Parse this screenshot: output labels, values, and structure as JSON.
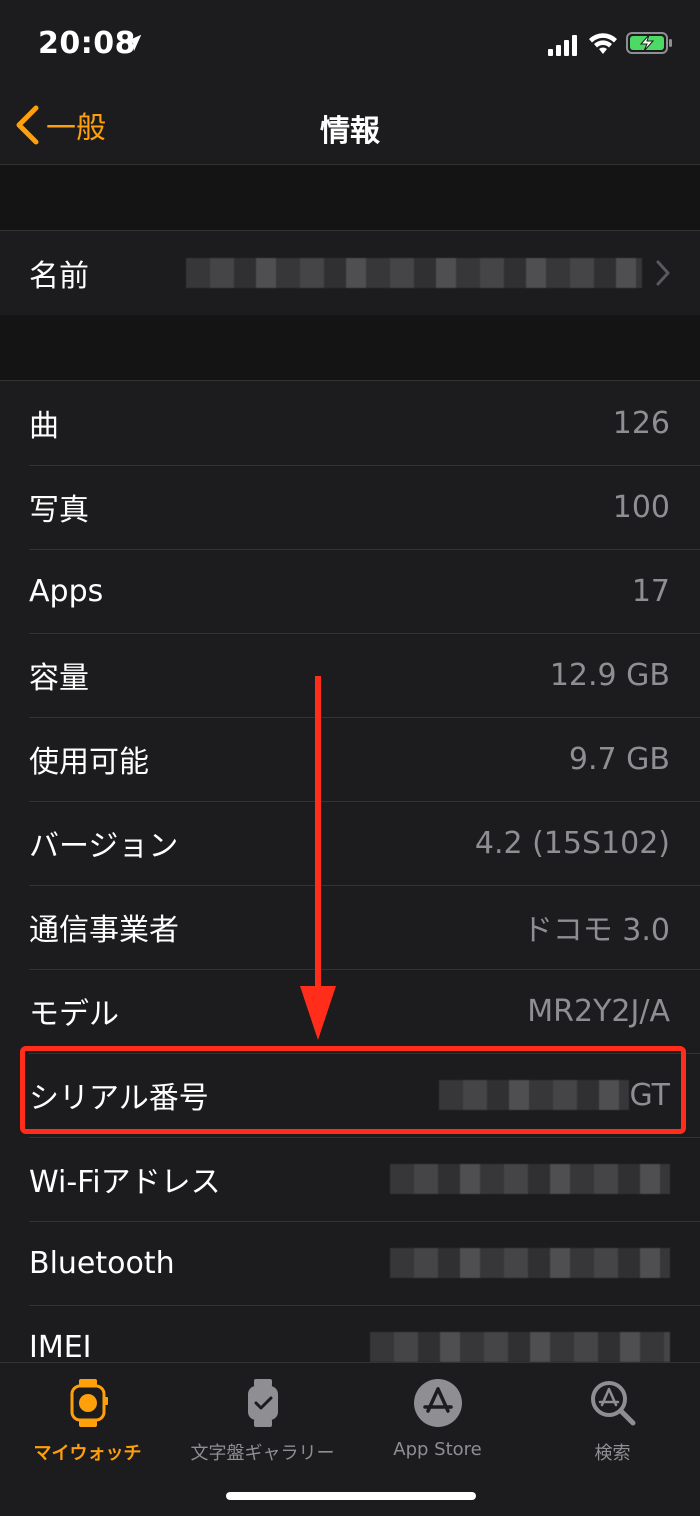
{
  "status_bar": {
    "time": "20:08"
  },
  "nav": {
    "back_label": "一般",
    "title": "情報"
  },
  "name_row": {
    "label": "名前"
  },
  "rows": [
    {
      "label": "曲",
      "value": "126"
    },
    {
      "label": "写真",
      "value": "100"
    },
    {
      "label": "Apps",
      "value": "17"
    },
    {
      "label": "容量",
      "value": "12.9 GB"
    },
    {
      "label": "使用可能",
      "value": "9.7 GB"
    },
    {
      "label": "バージョン",
      "value": "4.2 (15S102)"
    },
    {
      "label": "通信事業者",
      "value": "ドコモ 3.0"
    },
    {
      "label": "モデル",
      "value": "MR2Y2J/A"
    },
    {
      "label": "シリアル番号",
      "value": "GT"
    },
    {
      "label": "Wi-Fiアドレス",
      "value": ""
    },
    {
      "label": "Bluetooth",
      "value": ""
    },
    {
      "label": "IMEI",
      "value": ""
    }
  ],
  "tabs": [
    {
      "label": "マイウォッチ",
      "icon": "watch-icon",
      "active": true
    },
    {
      "label": "文字盤ギャラリー",
      "icon": "watch-face-icon",
      "active": false
    },
    {
      "label": "App Store",
      "icon": "app-store-icon",
      "active": false
    },
    {
      "label": "検索",
      "icon": "search-icon",
      "active": false
    }
  ],
  "colors": {
    "accent": "#ff9f0a",
    "highlight": "#ff2d1a",
    "background": "#1c1c1e"
  }
}
